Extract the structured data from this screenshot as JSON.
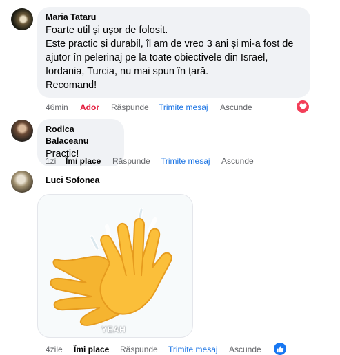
{
  "comments": [
    {
      "author": "Maria Tataru",
      "text": "Foarte util și ușor de folosit.\nEste practic și durabil, îl am de vreo 3 ani și mi-a fost de\najutor în pelerinaj pe la toate obiectivele din Israel,\nIordania, Turcia, nu mai spun în țară.\nRecomand!",
      "time": "46min",
      "like_label": "Ador",
      "reply_label": "Răspunde",
      "message_label": "Trimite mesaj",
      "hide_label": "Ascunde",
      "reaction_icon": "heart-icon"
    },
    {
      "author": "Rodica Balaceanu",
      "text": "Practic!",
      "time": "1zi",
      "like_label": "Îmi place",
      "reply_label": "Răspunde",
      "message_label": "Trimite mesaj",
      "hide_label": "Ascunde"
    },
    {
      "author": "Luci Sofonea",
      "sticker_caption": "YEAH",
      "sticker_icon": "clapping-hands-icon",
      "time": "4zile",
      "like_label": "Îmi place",
      "reply_label": "Răspunde",
      "message_label": "Trimite mesaj",
      "hide_label": "Ascunde",
      "reaction_icon": "like-icon"
    }
  ],
  "colors": {
    "bubble": "#f0f2f5",
    "love_red": "#e41e3f",
    "link_blue": "#1b74e4",
    "meta_gray": "#65676b",
    "clap_yellow": "#fbbf3a"
  }
}
